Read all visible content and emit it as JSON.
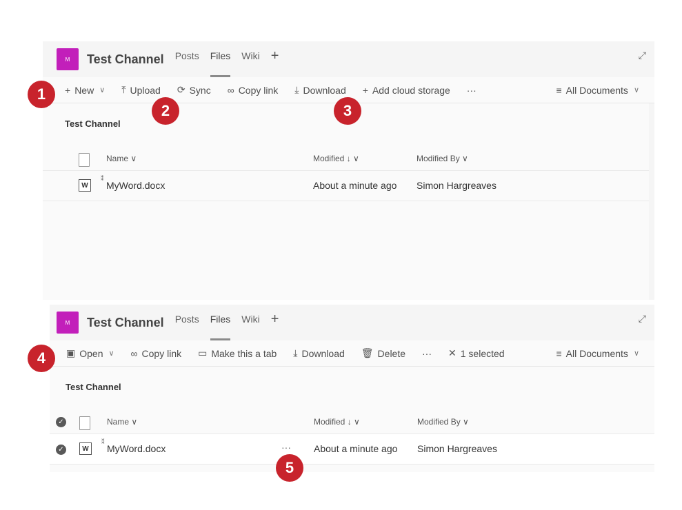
{
  "panel1": {
    "avatar": "M",
    "channel_title": "Test Channel",
    "tabs": [
      "Posts",
      "Files",
      "Wiki"
    ],
    "toolbar": {
      "new": "New",
      "upload": "Upload",
      "sync": "Sync",
      "copy_link": "Copy link",
      "download": "Download",
      "add_cloud": "Add cloud storage",
      "more": "···",
      "view": "All Documents"
    },
    "library_title": "Test Channel",
    "columns": {
      "name": "Name",
      "modified": "Modified",
      "modified_by": "Modified By"
    },
    "rows": [
      {
        "name": "MyWord.docx",
        "modified": "About a minute ago",
        "modified_by": "Simon Hargreaves"
      }
    ]
  },
  "panel2": {
    "avatar": "M",
    "channel_title": "Test Channel",
    "tabs": [
      "Posts",
      "Files",
      "Wiki"
    ],
    "toolbar": {
      "open": "Open",
      "copy_link": "Copy link",
      "make_tab": "Make this a tab",
      "download": "Download",
      "delete": "Delete",
      "more": "···",
      "selected": "1 selected",
      "view": "All Documents"
    },
    "library_title": "Test Channel",
    "columns": {
      "name": "Name",
      "modified": "Modified",
      "modified_by": "Modified By"
    },
    "rows": [
      {
        "name": "MyWord.docx",
        "modified": "About a minute ago",
        "modified_by": "Simon Hargreaves",
        "more": "···"
      }
    ]
  },
  "badges": [
    "1",
    "2",
    "3",
    "4",
    "5"
  ],
  "colors": {
    "avatar": "#c21fba",
    "badge": "#c8232c"
  }
}
